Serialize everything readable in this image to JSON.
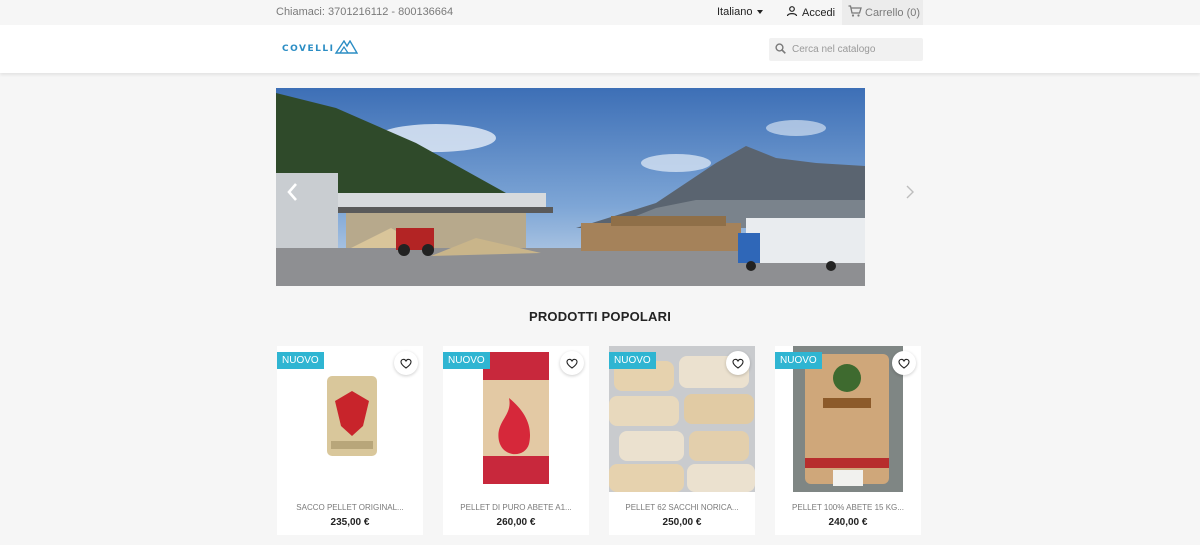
{
  "topbar": {
    "phone": "Chiamaci: 3701216112 - 800136664",
    "language": "Italiano",
    "login": "Accedi",
    "cart": "Carrello (0)"
  },
  "header": {
    "logo_text": "COVELLI",
    "search_placeholder": "Cerca nel catalogo"
  },
  "section_title": "PRODOTTI POPOLARI",
  "products": [
    {
      "badge": "NUOVO",
      "name": "SACCO PELLET ORIGINAL...",
      "price": "235,00 €"
    },
    {
      "badge": "NUOVO",
      "name": "PELLET DI PURO ABETE A1...",
      "price": "260,00 €"
    },
    {
      "badge": "NUOVO",
      "name": "PELLET 62 SACCHI NORICA...",
      "price": "250,00 €"
    },
    {
      "badge": "NUOVO",
      "name": "PELLET 100% ABETE 15 KG...",
      "price": "240,00 €"
    }
  ],
  "colors": {
    "accent": "#2fb5d2",
    "brand": "#2b8dc4"
  }
}
